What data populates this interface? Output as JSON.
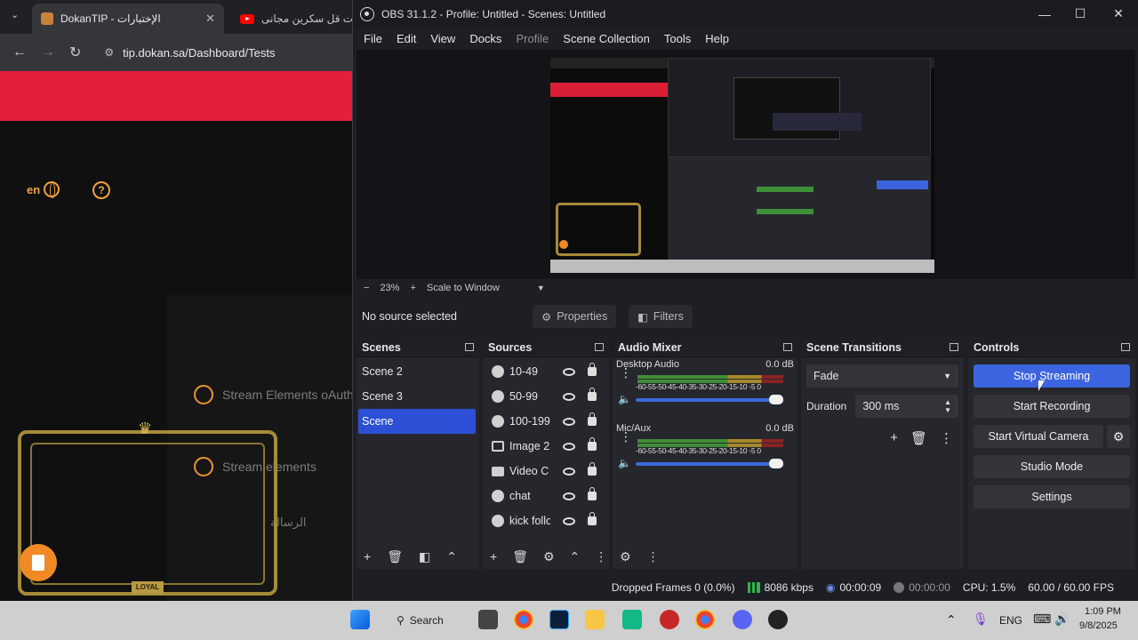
{
  "browser": {
    "tab_active_title": "DokanTIP - الإختبارات",
    "tab_active_close": "✕",
    "tab_second_title": "ت قل سكرين مجانى -",
    "url": "tip.dokan.sa/Dashboard/Tests",
    "lang_label": "en",
    "help_glyph": "?",
    "stream_elements_1": "Stream Elements oAuth",
    "stream_elements_2": "Stream elements",
    "arabic_label": "الرسالة",
    "overlay_badge": "LOYAL",
    "colors": {
      "accent_red": "#e3203b",
      "accent_orange": "#f2a33a"
    }
  },
  "obs": {
    "window_title": "OBS 31.1.2 - Profile: Untitled - Scenes: Untitled",
    "menu": [
      "File",
      "Edit",
      "View",
      "Docks",
      "Profile",
      "Scene Collection",
      "Tools",
      "Help"
    ],
    "zoom": {
      "minus": "−",
      "percent": "23%",
      "plus": "+",
      "mode": "Scale to Window"
    },
    "source_bar": {
      "status": "No source selected",
      "properties": "Properties",
      "filters": "Filters"
    },
    "scenes": {
      "title": "Scenes",
      "items": [
        "Scene 2",
        "Scene 3",
        "Scene"
      ],
      "selected": "Scene"
    },
    "sources": {
      "title": "Sources",
      "items": [
        "10-49",
        "50-99",
        "100-199",
        "Image 2",
        "Video C",
        "chat",
        "kick follo"
      ]
    },
    "audio_mixer": {
      "title": "Audio Mixer",
      "scale": "-60-55-50-45-40-35-30-25-20-15-10 -5  0",
      "channels": [
        {
          "name": "Desktop Audio",
          "db": "0.0 dB"
        },
        {
          "name": "Mic/Aux",
          "db": "0.0 dB"
        }
      ]
    },
    "transitions": {
      "title": "Scene Transitions",
      "type": "Fade",
      "duration_label": "Duration",
      "duration_value": "300 ms"
    },
    "controls": {
      "title": "Controls",
      "stop_streaming": "Stop Streaming",
      "start_recording": "Start Recording",
      "start_virtual_camera": "Start Virtual Camera",
      "studio_mode": "Studio Mode",
      "settings": "Settings"
    },
    "status": {
      "dropped_frames": "Dropped Frames 0 (0.0%)",
      "bitrate": "8086 kbps",
      "stream_time": "00:00:09",
      "record_time": "00:00:00",
      "cpu": "CPU: 1.5%",
      "fps": "60.00 / 60.00 FPS"
    },
    "colors": {
      "primary_button": "#3c64e0",
      "selection": "#2c4fd6"
    }
  },
  "taskbar": {
    "search_label": "Search",
    "language": "ENG",
    "time": "1:09 PM",
    "date": "9/8/2025"
  }
}
